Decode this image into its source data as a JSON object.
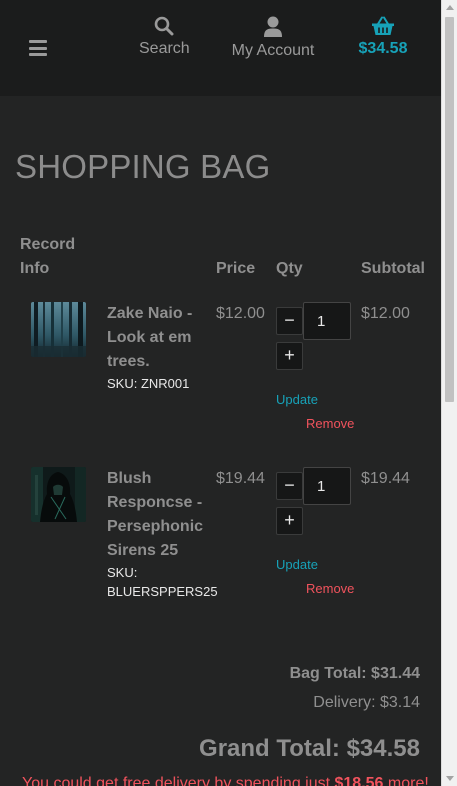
{
  "header": {
    "search_label": "Search",
    "account_label": "My Account",
    "bag_total": "$34.58"
  },
  "page_title": "SHOPPING BAG",
  "table_headers": {
    "info": "Record Info",
    "price": "Price",
    "qty": "Qty",
    "subtotal": "Subtotal"
  },
  "items": [
    {
      "name": "Zake Naio - Look at em trees.",
      "sku": "SKU: ZNR001",
      "price": "$12.00",
      "qty": "1",
      "subtotal": "$12.00",
      "update_label": "Update",
      "remove_label": "Remove",
      "thumb_icon": "forest-image"
    },
    {
      "name": "Blush Responcse - Persephonic Sirens 25",
      "sku": "SKU: BLUERSPPERS25",
      "price": "$19.44",
      "qty": "1",
      "subtotal": "$19.44",
      "update_label": "Update",
      "remove_label": "Remove",
      "thumb_icon": "hooded-figure-image"
    }
  ],
  "totals": {
    "bag_total": "Bag Total: $31.44",
    "delivery": "Delivery: $3.14",
    "grand_total": "Grand Total: $34.58",
    "free_note_prefix": "You could get free delivery by spending just ",
    "free_note_amount": "$18.56",
    "free_note_suffix": " more!"
  },
  "colors": {
    "background": "#232424",
    "header": "#1b1c1c",
    "accent": "#17a2b8",
    "danger": "#f1535d"
  }
}
